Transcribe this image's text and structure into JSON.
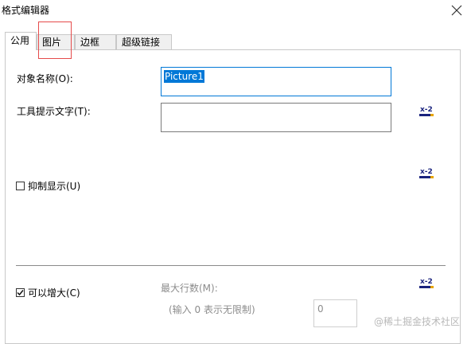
{
  "window": {
    "title": "格式编辑器"
  },
  "tabs": [
    {
      "label": "公用",
      "active": true
    },
    {
      "label": "图片",
      "active": false
    },
    {
      "label": "边框",
      "active": false
    },
    {
      "label": "超级链接",
      "active": false
    }
  ],
  "form": {
    "object_name_label": "对象名称(O):",
    "object_name_value": "Picture1",
    "tooltip_label": "工具提示文字(T):",
    "tooltip_value": "",
    "suppress_label": "抑制显示(U)",
    "suppress_checked": false,
    "can_grow_label": "可以增大(C)",
    "can_grow_checked": true,
    "max_rows_label": "最大行数(M):",
    "max_rows_hint": "(输入 0 表示无限制)",
    "max_rows_value": "0"
  },
  "icons": {
    "formula_button": "formula-x2-icon",
    "close": "close-icon"
  },
  "colors": {
    "selection": "#0078d7",
    "highlight_box": "#e54b4b",
    "disabled_text": "#8c8c8c"
  },
  "watermark": "@稀土掘金技术社区"
}
